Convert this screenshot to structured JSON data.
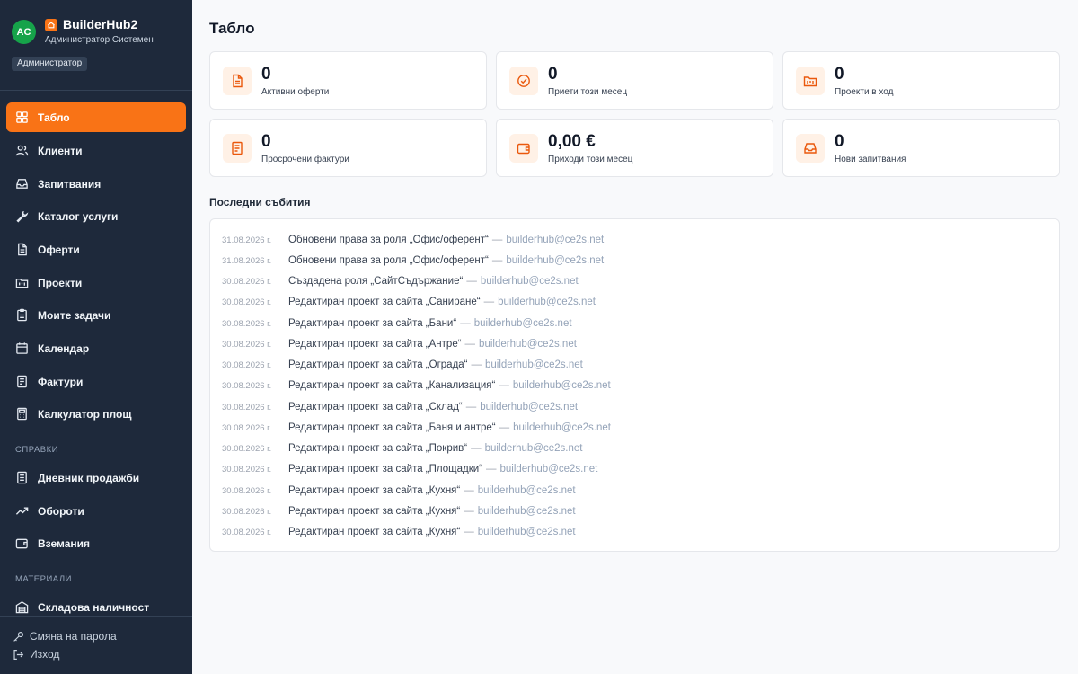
{
  "brand": {
    "avatar_initials": "AC",
    "name": "BuilderHub2",
    "subtitle": "Администратор Системен",
    "role": "Администратор"
  },
  "nav": {
    "items": [
      {
        "label": "Табло",
        "icon": "dashboard-icon",
        "active": true
      },
      {
        "label": "Клиенти",
        "icon": "users-icon"
      },
      {
        "label": "Запитвания",
        "icon": "inbox-icon"
      },
      {
        "label": "Каталог услуги",
        "icon": "wrench-icon"
      },
      {
        "label": "Оферти",
        "icon": "document-icon"
      },
      {
        "label": "Проекти",
        "icon": "folder-kanban-icon"
      },
      {
        "label": "Моите задачи",
        "icon": "clipboard-icon"
      },
      {
        "label": "Календар",
        "icon": "calendar-icon"
      },
      {
        "label": "Фактури",
        "icon": "invoice-icon"
      },
      {
        "label": "Калкулатор площ",
        "icon": "calculator-icon"
      }
    ],
    "section_reports": "СПРАВКИ",
    "reports": [
      {
        "label": "Дневник продажби",
        "icon": "book-icon"
      },
      {
        "label": "Обороти",
        "icon": "trending-up-icon"
      },
      {
        "label": "Вземания",
        "icon": "wallet-icon"
      }
    ],
    "section_materials": "МАТЕРИАЛИ",
    "materials": [
      {
        "label": "Складова наличност",
        "icon": "warehouse-icon"
      }
    ]
  },
  "bottom": {
    "change_password": "Смяна на парола",
    "logout": "Изход"
  },
  "page": {
    "title": "Табло"
  },
  "stats": [
    {
      "value": "0",
      "label": "Активни оферти",
      "icon": "document-icon"
    },
    {
      "value": "0",
      "label": "Приети този месец",
      "icon": "check-circle-icon"
    },
    {
      "value": "0",
      "label": "Проекти в ход",
      "icon": "folder-kanban-icon"
    },
    {
      "value": "0",
      "label": "Просрочени фактури",
      "icon": "invoice-icon"
    },
    {
      "value": "0,00 €",
      "label": "Приходи този месец",
      "icon": "wallet-icon"
    },
    {
      "value": "0",
      "label": "Нови запитвания",
      "icon": "inbox-icon"
    }
  ],
  "colors": {
    "accent": "#f97316",
    "sidebar": "#1e293b",
    "icon_bg": "#fff1e6"
  },
  "events": {
    "title": "Последни събития",
    "items": [
      {
        "date": "31.08.2026 г.",
        "text": "Обновени права за роля „Офис/оферент“",
        "user": "builderhub@ce2s.net"
      },
      {
        "date": "31.08.2026 г.",
        "text": "Обновени права за роля „Офис/оферент“",
        "user": "builderhub@ce2s.net"
      },
      {
        "date": "30.08.2026 г.",
        "text": "Създадена роля „СайтСъдържание“",
        "user": "builderhub@ce2s.net"
      },
      {
        "date": "30.08.2026 г.",
        "text": "Редактиран проект за сайта „Саниране“",
        "user": "builderhub@ce2s.net"
      },
      {
        "date": "30.08.2026 г.",
        "text": "Редактиран проект за сайта „Бани“",
        "user": "builderhub@ce2s.net"
      },
      {
        "date": "30.08.2026 г.",
        "text": "Редактиран проект за сайта „Антре“",
        "user": "builderhub@ce2s.net"
      },
      {
        "date": "30.08.2026 г.",
        "text": "Редактиран проект за сайта „Ограда“",
        "user": "builderhub@ce2s.net"
      },
      {
        "date": "30.08.2026 г.",
        "text": "Редактиран проект за сайта „Канализация“",
        "user": "builderhub@ce2s.net"
      },
      {
        "date": "30.08.2026 г.",
        "text": "Редактиран проект за сайта „Склад“",
        "user": "builderhub@ce2s.net"
      },
      {
        "date": "30.08.2026 г.",
        "text": "Редактиран проект за сайта „Баня и антре“",
        "user": "builderhub@ce2s.net"
      },
      {
        "date": "30.08.2026 г.",
        "text": "Редактиран проект за сайта „Покрив“",
        "user": "builderhub@ce2s.net"
      },
      {
        "date": "30.08.2026 г.",
        "text": "Редактиран проект за сайта „Площадки“",
        "user": "builderhub@ce2s.net"
      },
      {
        "date": "30.08.2026 г.",
        "text": "Редактиран проект за сайта „Кухня“",
        "user": "builderhub@ce2s.net"
      },
      {
        "date": "30.08.2026 г.",
        "text": "Редактиран проект за сайта „Кухня“",
        "user": "builderhub@ce2s.net"
      },
      {
        "date": "30.08.2026 г.",
        "text": "Редактиран проект за сайта „Кухня“",
        "user": "builderhub@ce2s.net"
      }
    ]
  }
}
